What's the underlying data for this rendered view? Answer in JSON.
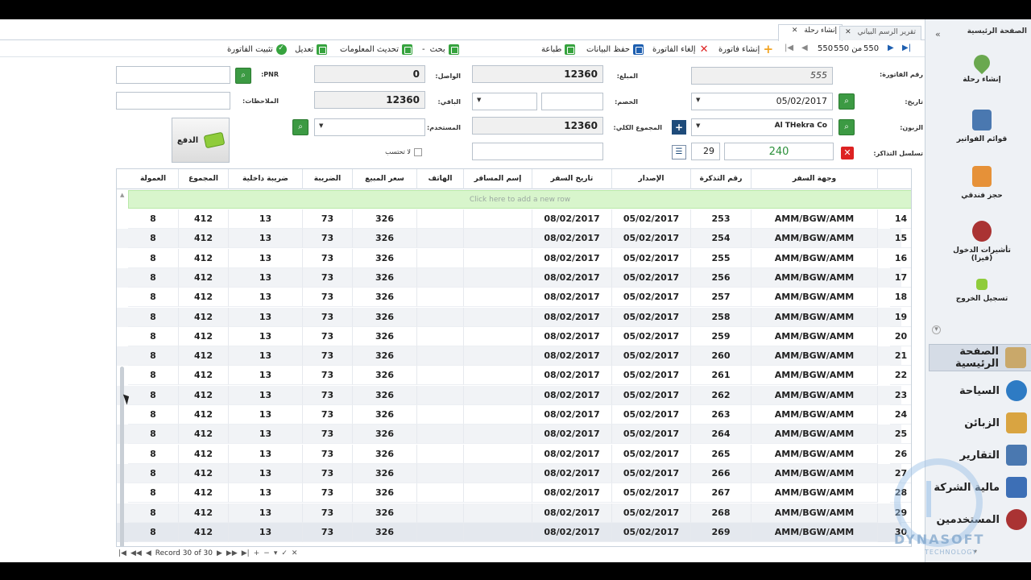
{
  "tabs": [
    {
      "label": "إنشاء رحلة",
      "active": true
    },
    {
      "label": "تقرير الرسم البياني",
      "active": false
    }
  ],
  "toolbar": {
    "confirm": "تثبيت الفاتورة",
    "edit": "تعديل",
    "refresh": "تحديث المعلومات",
    "search": "بحث",
    "search_sep": "-",
    "print": "طباعة",
    "save": "حفظ البيانات",
    "cancel": "إلغاء الفاتورة",
    "create": "إنشاء فاتورة",
    "pager_total": "550",
    "pager_of": "من 550",
    "pager_current": "550"
  },
  "form": {
    "invoice_no_label": "رقم الفاتورة:",
    "invoice_no": "555",
    "date_label": "تاريخ:",
    "date": "05/02/2017",
    "customer_label": "الزبون:",
    "customer": "Al THekra Co",
    "tickets_label": "تسلسل التذاكر:",
    "tickets_value": "240",
    "tickets_count": "29",
    "amount_label": "المبلغ:",
    "amount": "12360",
    "discount_label": "الخصم:",
    "total_label": "المجموع الكلي:",
    "total": "12360",
    "arrived_label": "الواصل:",
    "arrived": "0",
    "remaining_label": "الباقي:",
    "remaining": "12360",
    "user_label": "المستخدم:",
    "pnr_label": "PNR:",
    "notes_label": "الملاحظات:",
    "no_calc_label": "لا تحتسب",
    "pay_label": "الدفع"
  },
  "grid": {
    "headers": [
      "وجهة السفر",
      "رقم التذكرة",
      "الإصدار",
      "تاريخ السفر",
      "إسم المسافر",
      "الهاتف",
      "سعر المبيع",
      "الضريبة",
      "ضريبة داخلية",
      "المجموع",
      "العمولة"
    ],
    "new_row_text": "Click here to add a new row",
    "rows": [
      {
        "n": "14",
        "dest": "AMM/BGW/AMM",
        "ticket": "253",
        "issue": "05/02/2017",
        "travel": "08/02/2017",
        "name": "",
        "phone": "",
        "price": "326",
        "tax": "73",
        "intax": "13",
        "total": "412",
        "comm": "8"
      },
      {
        "n": "15",
        "dest": "AMM/BGW/AMM",
        "ticket": "254",
        "issue": "05/02/2017",
        "travel": "08/02/2017",
        "name": "",
        "phone": "",
        "price": "326",
        "tax": "73",
        "intax": "13",
        "total": "412",
        "comm": "8"
      },
      {
        "n": "16",
        "dest": "AMM/BGW/AMM",
        "ticket": "255",
        "issue": "05/02/2017",
        "travel": "08/02/2017",
        "name": "",
        "phone": "",
        "price": "326",
        "tax": "73",
        "intax": "13",
        "total": "412",
        "comm": "8"
      },
      {
        "n": "17",
        "dest": "AMM/BGW/AMM",
        "ticket": "256",
        "issue": "05/02/2017",
        "travel": "08/02/2017",
        "name": "",
        "phone": "",
        "price": "326",
        "tax": "73",
        "intax": "13",
        "total": "412",
        "comm": "8"
      },
      {
        "n": "18",
        "dest": "AMM/BGW/AMM",
        "ticket": "257",
        "issue": "05/02/2017",
        "travel": "08/02/2017",
        "name": "",
        "phone": "",
        "price": "326",
        "tax": "73",
        "intax": "13",
        "total": "412",
        "comm": "8"
      },
      {
        "n": "19",
        "dest": "AMM/BGW/AMM",
        "ticket": "258",
        "issue": "05/02/2017",
        "travel": "08/02/2017",
        "name": "",
        "phone": "",
        "price": "326",
        "tax": "73",
        "intax": "13",
        "total": "412",
        "comm": "8"
      },
      {
        "n": "20",
        "dest": "AMM/BGW/AMM",
        "ticket": "259",
        "issue": "05/02/2017",
        "travel": "08/02/2017",
        "name": "",
        "phone": "",
        "price": "326",
        "tax": "73",
        "intax": "13",
        "total": "412",
        "comm": "8"
      },
      {
        "n": "21",
        "dest": "AMM/BGW/AMM",
        "ticket": "260",
        "issue": "05/02/2017",
        "travel": "08/02/2017",
        "name": "",
        "phone": "",
        "price": "326",
        "tax": "73",
        "intax": "13",
        "total": "412",
        "comm": "8"
      },
      {
        "n": "22",
        "dest": "AMM/BGW/AMM",
        "ticket": "261",
        "issue": "05/02/2017",
        "travel": "08/02/2017",
        "name": "",
        "phone": "",
        "price": "326",
        "tax": "73",
        "intax": "13",
        "total": "412",
        "comm": "8"
      },
      {
        "n": "23",
        "dest": "AMM/BGW/AMM",
        "ticket": "262",
        "issue": "05/02/2017",
        "travel": "08/02/2017",
        "name": "",
        "phone": "",
        "price": "326",
        "tax": "73",
        "intax": "13",
        "total": "412",
        "comm": "8"
      },
      {
        "n": "24",
        "dest": "AMM/BGW/AMM",
        "ticket": "263",
        "issue": "05/02/2017",
        "travel": "08/02/2017",
        "name": "",
        "phone": "",
        "price": "326",
        "tax": "73",
        "intax": "13",
        "total": "412",
        "comm": "8"
      },
      {
        "n": "25",
        "dest": "AMM/BGW/AMM",
        "ticket": "264",
        "issue": "05/02/2017",
        "travel": "08/02/2017",
        "name": "",
        "phone": "",
        "price": "326",
        "tax": "73",
        "intax": "13",
        "total": "412",
        "comm": "8"
      },
      {
        "n": "26",
        "dest": "AMM/BGW/AMM",
        "ticket": "265",
        "issue": "05/02/2017",
        "travel": "08/02/2017",
        "name": "",
        "phone": "",
        "price": "326",
        "tax": "73",
        "intax": "13",
        "total": "412",
        "comm": "8"
      },
      {
        "n": "27",
        "dest": "AMM/BGW/AMM",
        "ticket": "266",
        "issue": "05/02/2017",
        "travel": "08/02/2017",
        "name": "",
        "phone": "",
        "price": "326",
        "tax": "73",
        "intax": "13",
        "total": "412",
        "comm": "8"
      },
      {
        "n": "28",
        "dest": "AMM/BGW/AMM",
        "ticket": "267",
        "issue": "05/02/2017",
        "travel": "08/02/2017",
        "name": "",
        "phone": "",
        "price": "326",
        "tax": "73",
        "intax": "13",
        "total": "412",
        "comm": "8"
      },
      {
        "n": "29",
        "dest": "AMM/BGW/AMM",
        "ticket": "268",
        "issue": "05/02/2017",
        "travel": "08/02/2017",
        "name": "",
        "phone": "",
        "price": "326",
        "tax": "73",
        "intax": "13",
        "total": "412",
        "comm": "8"
      },
      {
        "n": "30",
        "dest": "AMM/BGW/AMM",
        "ticket": "269",
        "issue": "05/02/2017",
        "travel": "08/02/2017",
        "name": "",
        "phone": "",
        "price": "326",
        "tax": "73",
        "intax": "13",
        "total": "412",
        "comm": "8"
      }
    ],
    "record_text": "Record 30 of 30"
  },
  "sidebar": {
    "header": "الصفحة الرئيسية",
    "items": [
      {
        "label": "إنشاء رحلة",
        "icon": "map-pin-icon",
        "color": "#6aa84f"
      },
      {
        "label": "قوائم الفواتير",
        "icon": "invoice-search-icon",
        "color": "#4a78b0"
      },
      {
        "label": "حجز فندقي",
        "icon": "hotel-icon",
        "color": "#e69138"
      },
      {
        "label": "تأشيرات الدخول (فيزا)",
        "icon": "visa-person-icon",
        "color": "#a33"
      },
      {
        "label": "تسجيل الخروج",
        "icon": "logout-icon",
        "color": "#8fcc3b"
      }
    ],
    "groups": [
      {
        "label": "الصفحة الرئيسية",
        "icon": "home-icon",
        "color": "#c9a86a",
        "active": true
      },
      {
        "label": "السياحة",
        "icon": "globe-icon",
        "color": "#2e7bc4",
        "active": false
      },
      {
        "label": "الزبائن",
        "icon": "customers-icon",
        "color": "#d9a441",
        "active": false
      },
      {
        "label": "التقارير",
        "icon": "reports-icon",
        "color": "#4a78b0",
        "active": false
      },
      {
        "label": "مالية الشركة",
        "icon": "finance-icon",
        "color": "#3d6fb6",
        "active": false
      },
      {
        "label": "المستخدمين",
        "icon": "users-icon",
        "color": "#a33",
        "active": false
      }
    ]
  },
  "watermark": {
    "name": "DYNASOFT",
    "sub": "TECHNOLOGY"
  }
}
